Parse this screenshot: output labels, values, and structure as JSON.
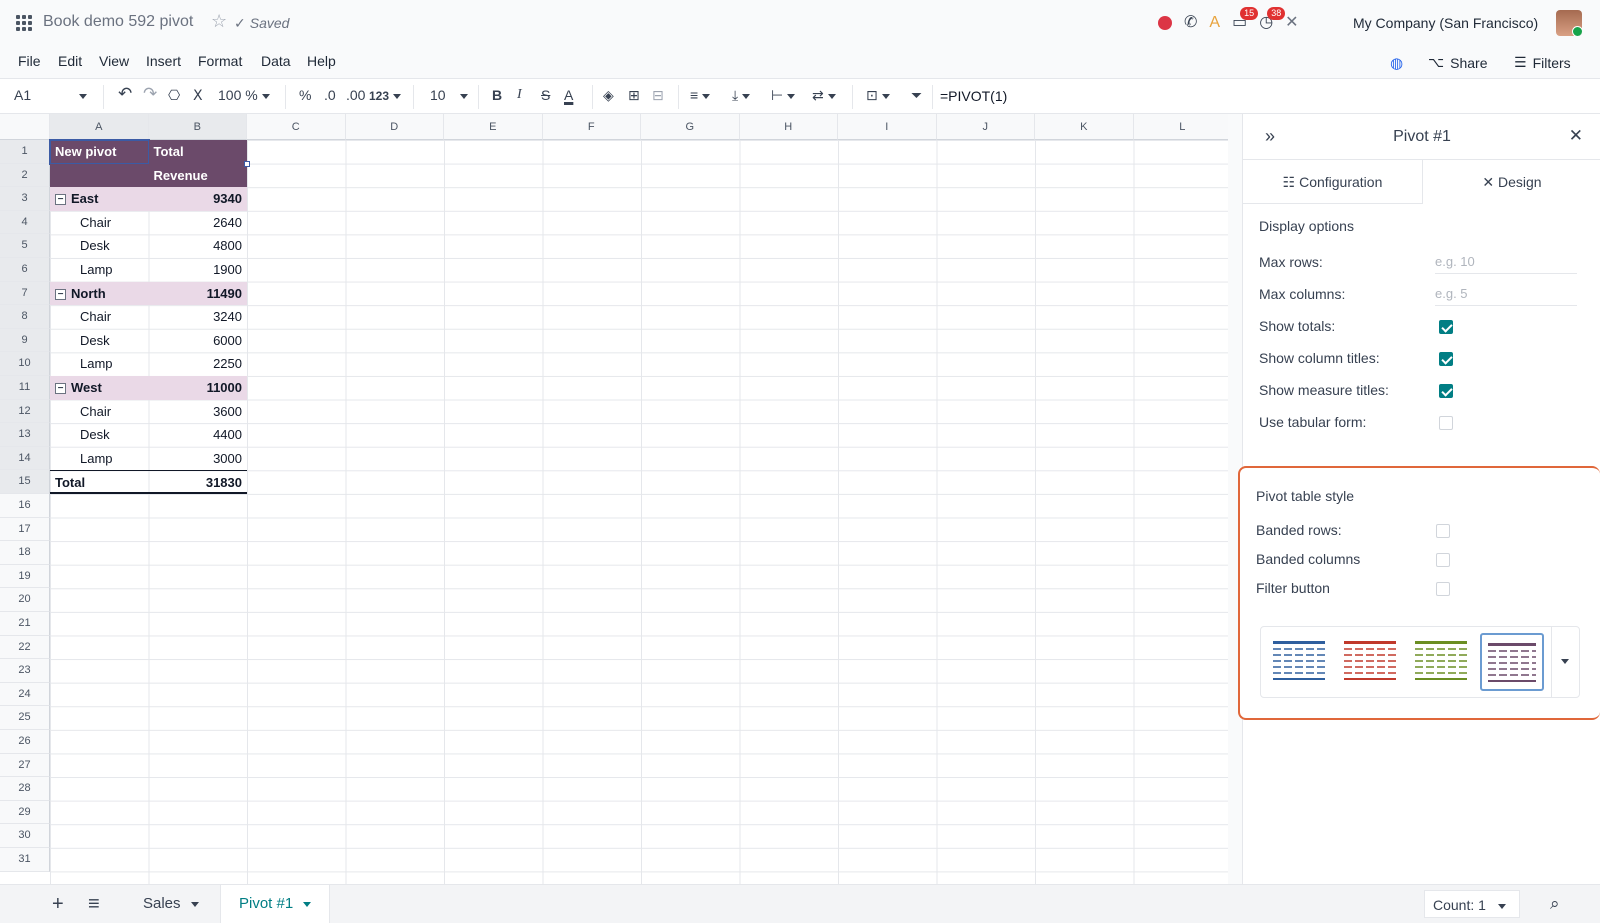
{
  "topbar": {
    "title": "Book demo 592 pivot",
    "saved": "Saved",
    "company": "My Company (San Francisco)",
    "badges": {
      "messages": "15",
      "activities": "38"
    }
  },
  "menu": {
    "items": [
      "File",
      "Edit",
      "View",
      "Insert",
      "Format",
      "Data",
      "Help"
    ],
    "share": "Share",
    "filters": "Filters"
  },
  "toolbar": {
    "cell_ref": "A1",
    "zoom": "100 %",
    "percent": "%",
    "dec_less": ".0",
    "dec_more": ".00",
    "number_fmt": "123",
    "font_size": "10",
    "formula": "=PIVOT(1)"
  },
  "grid": {
    "columns": [
      "A",
      "B",
      "C",
      "D",
      "E",
      "F",
      "G",
      "H",
      "I",
      "J",
      "K",
      "L"
    ],
    "rows": [
      "1",
      "2",
      "3",
      "4",
      "5",
      "6",
      "7",
      "8",
      "9",
      "10",
      "11",
      "12",
      "13",
      "14",
      "15",
      "16",
      "17",
      "18",
      "19",
      "20",
      "21",
      "22",
      "23",
      "24",
      "25",
      "26",
      "27",
      "28",
      "29",
      "30",
      "31"
    ],
    "pivot": {
      "header_a": "New pivot",
      "header_b": "Total",
      "measure": "Revenue",
      "groups": [
        {
          "name": "East",
          "total": "9340",
          "items": [
            {
              "name": "Chair",
              "value": "2640"
            },
            {
              "name": "Desk",
              "value": "4800"
            },
            {
              "name": "Lamp",
              "value": "1900"
            }
          ]
        },
        {
          "name": "North",
          "total": "11490",
          "items": [
            {
              "name": "Chair",
              "value": "3240"
            },
            {
              "name": "Desk",
              "value": "6000"
            },
            {
              "name": "Lamp",
              "value": "2250"
            }
          ]
        },
        {
          "name": "West",
          "total": "11000",
          "items": [
            {
              "name": "Chair",
              "value": "3600"
            },
            {
              "name": "Desk",
              "value": "4400"
            },
            {
              "name": "Lamp",
              "value": "3000"
            }
          ]
        }
      ],
      "total_label": "Total",
      "grand_total": "31830"
    }
  },
  "panel": {
    "title": "Pivot #1",
    "tabs": [
      "Configuration",
      "Design"
    ],
    "display_options": {
      "title": "Display options",
      "max_rows_label": "Max rows:",
      "max_rows_placeholder": "e.g. 10",
      "max_columns_label": "Max columns:",
      "max_columns_placeholder": "e.g. 5",
      "checks": [
        {
          "label": "Show totals:",
          "checked": true
        },
        {
          "label": "Show column titles:",
          "checked": true
        },
        {
          "label": "Show measure titles:",
          "checked": true
        },
        {
          "label": "Use tabular form:",
          "checked": false
        }
      ]
    },
    "style": {
      "title": "Pivot table style",
      "checks": [
        {
          "label": "Banded rows:",
          "checked": false
        },
        {
          "label": "Banded columns",
          "checked": false
        },
        {
          "label": "Filter button",
          "checked": false
        }
      ],
      "thumbnails": [
        {
          "color": "#2f5f9e",
          "selected": false
        },
        {
          "color": "#c0392b",
          "selected": false
        },
        {
          "color": "#6b8e23",
          "selected": false
        },
        {
          "color": "#6b4a6a",
          "selected": true
        }
      ]
    }
  },
  "bottom": {
    "sheets": [
      "Sales",
      "Pivot #1"
    ],
    "count": "Count: 1"
  },
  "colors": {
    "accent": "#017e84",
    "pivot_header": "#6b4a6a",
    "pivot_group": "#ead9e7",
    "highlight": "#e0673a"
  }
}
